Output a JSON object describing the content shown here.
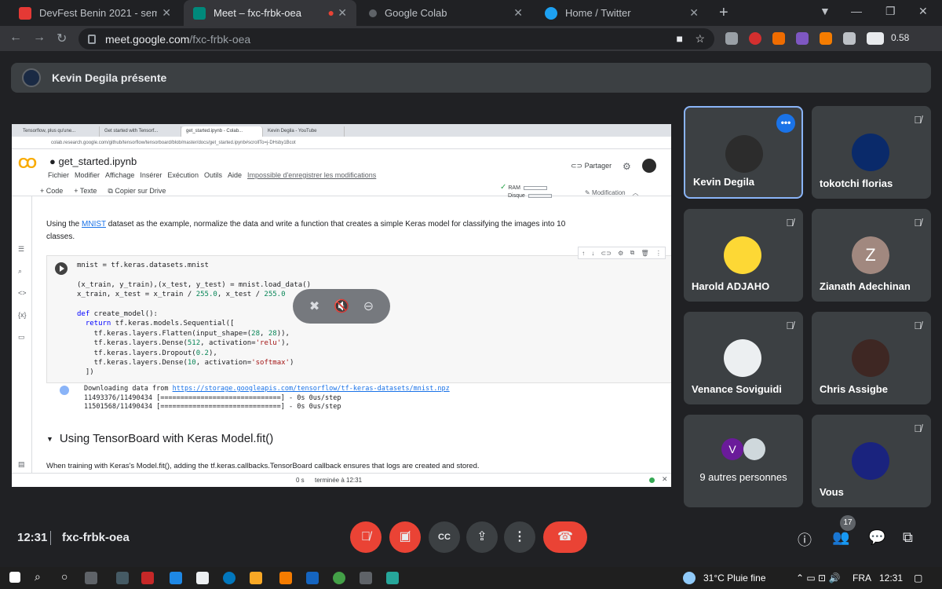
{
  "browser": {
    "tabs": [
      {
        "title": "DevFest Benin 2021 - semassaep"
      },
      {
        "title": "Meet – fxc-frbk-oea"
      },
      {
        "title": "Google Colab"
      },
      {
        "title": "Home / Twitter"
      }
    ],
    "address": {
      "host": "meet.google.com",
      "path": "/fxc-frbk-oea"
    },
    "toolbar_value": "0.58"
  },
  "meet": {
    "presenter_text": "Kevin Degila présente",
    "time": "12:31",
    "meeting_code": "fxc-frbk-oea",
    "participant_count": "17",
    "participants": [
      {
        "name": "Kevin Degila"
      },
      {
        "name": "tokotchi florias"
      },
      {
        "name": "Harold ADJAHO"
      },
      {
        "name": "Zianath Adechinan",
        "initial": "Z"
      },
      {
        "name": "Venance Soviguidi"
      },
      {
        "name": "Chris Assigbe"
      },
      {
        "name": "9 autres personnes",
        "initial": "V"
      },
      {
        "name": "Vous"
      }
    ]
  },
  "shared_screen": {
    "tabs": [
      "Tensorflow, plus qu'une...",
      "Get started with Tensorf...",
      "get_started.ipynb - Colab...",
      "Kevin Degila - YouTube"
    ],
    "url": "colab.research.google.com/github/tensorflow/tensorboard/blob/master/docs/get_started.ipynb#scrollTo=j-DHsby1Bcot",
    "notebook_title": "get_started.ipynb",
    "menu": [
      "Fichier",
      "Modifier",
      "Affichage",
      "Insérer",
      "Exécution",
      "Outils",
      "Aide"
    ],
    "unsaved": "Impossible d'enregistrer les modifications",
    "share": "Partager",
    "tools": [
      "+ Code",
      "+ Texte",
      "Copier sur Drive"
    ],
    "ram": "RAM",
    "disk": "Disque",
    "modification": "Modification",
    "para_pre": "Using the ",
    "para_link": "MNIST",
    "para_post": " dataset as the example, normalize the data and write a function that creates a simple Keras model for classifying the images into 10 classes.",
    "output": {
      "pre": "Downloading data from ",
      "link": "https://storage.googleapis.com/tensorflow/tf-keras-datasets/mnist.npz",
      "line2": "11493376/11490434 [==============================] - 0s 0us/step",
      "line3": "11501568/11490434 [==============================] - 0s 0us/step"
    },
    "section_heading": "Using TensorBoard with Keras Model.fit()",
    "cut_text": "When training with Keras's Model.fit(), adding the tf.keras.callbacks.TensorBoard callback ensures that logs are created and stored.",
    "status_time": "0 s",
    "status_done": "terminée à 12:31"
  },
  "taskbar": {
    "weather": "31°C  Pluie fine",
    "lang": "FRA",
    "time": "12:31"
  }
}
